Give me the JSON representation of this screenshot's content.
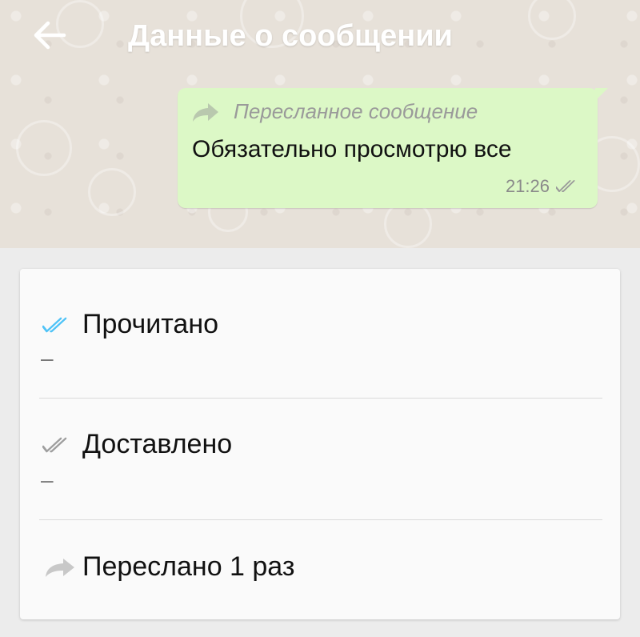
{
  "header": {
    "title": "Данные о сообщении",
    "back_icon": "arrow-left-icon"
  },
  "message": {
    "forwarded_label": "Пересланное сообщение",
    "text": "Обязательно просмотрю все",
    "time": "21:26",
    "status_icon": "double-check-icon"
  },
  "info": {
    "read": {
      "label": "Прочитано",
      "value": "–",
      "icon": "double-check-blue-icon",
      "icon_color": "#4fc3f7"
    },
    "delivered": {
      "label": "Доставлено",
      "value": "–",
      "icon": "double-check-gray-icon",
      "icon_color": "#9e9e9e"
    },
    "forwarded": {
      "label": "Переслано 1 раз",
      "icon": "forward-arrow-icon",
      "icon_color": "#c8c8c8"
    }
  },
  "colors": {
    "bubble": "#dcf8c6",
    "background": "#ececec",
    "card": "#fafafa"
  }
}
